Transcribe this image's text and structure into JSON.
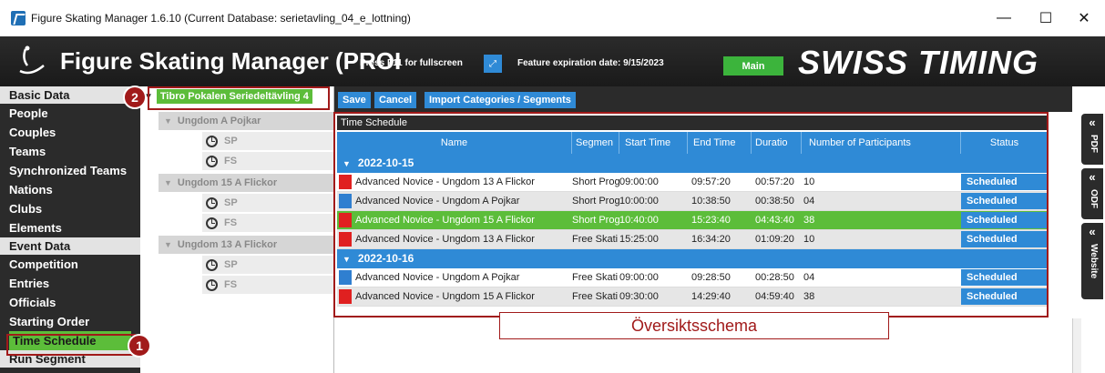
{
  "window": {
    "title": "Figure Skating Manager 1.6.10 (Current Database: serietavling_04_e_lottning)",
    "controls": {
      "minimize": "—",
      "maximize": "☐",
      "close": "✕"
    }
  },
  "banner": {
    "app_title": "Figure Skating Manager (PROI",
    "fullscreen_hint": "Press F11 for fullscreen",
    "fullscreen_icon": "⤢",
    "expiry": "Feature expiration date: 9/15/2023",
    "main_button": "Main",
    "brand": "SWISS TIMING"
  },
  "sidebar": {
    "sections": [
      {
        "header": "Basic Data",
        "items": [
          "People",
          "Couples",
          "Teams",
          "Synchronized Teams",
          "Nations",
          "Clubs",
          "Elements"
        ]
      },
      {
        "header": "Event Data",
        "items": [
          "Competition",
          "Entries",
          "Officials",
          "Starting Order",
          "Time Schedule"
        ]
      },
      {
        "header": "Run Segment",
        "items": []
      }
    ],
    "active_item": "Time Schedule"
  },
  "tree": {
    "root": "Tibro Pokalen Seriedeltävling 4",
    "categories": [
      {
        "name": "Ungdom A Pojkar",
        "segments": [
          "SP",
          "FS"
        ]
      },
      {
        "name": "Ungdom 15 A Flickor",
        "segments": [
          "SP",
          "FS"
        ]
      },
      {
        "name": "Ungdom 13 A Flickor",
        "segments": [
          "SP",
          "FS"
        ]
      }
    ]
  },
  "toolbar": {
    "save": "Save",
    "cancel": "Cancel",
    "import": "Import Categories / Segments"
  },
  "schedule": {
    "panel_title": "Time Schedule",
    "columns": [
      "Name",
      "Segmen",
      "Start Time",
      "End Time",
      "Duratio",
      "Number of Participants",
      "Status"
    ],
    "groups": [
      {
        "date": "2022-10-15",
        "rows": [
          {
            "color": "#e02020",
            "name": "Advanced Novice - Ungdom 13 A Flickor",
            "segment": "Short Prog",
            "start": "09:00:00",
            "end": "09:57:20",
            "duration": "00:57:20",
            "participants": "10",
            "status": "Scheduled"
          },
          {
            "color": "#2f7fd0",
            "name": "Advanced Novice - Ungdom A Pojkar",
            "segment": "Short Prog",
            "start": "10:00:00",
            "end": "10:38:50",
            "duration": "00:38:50",
            "participants": "04",
            "status": "Scheduled"
          },
          {
            "color": "#e02020",
            "name": "Advanced Novice - Ungdom 15 A Flickor",
            "segment": "Short Prog",
            "start": "10:40:00",
            "end": "15:23:40",
            "duration": "04:43:40",
            "participants": "38",
            "status": "Scheduled"
          },
          {
            "color": "#e02020",
            "name": "Advanced Novice - Ungdom 13 A Flickor",
            "segment": "Free Skati",
            "start": "15:25:00",
            "end": "16:34:20",
            "duration": "01:09:20",
            "participants": "10",
            "status": "Scheduled"
          }
        ]
      },
      {
        "date": "2022-10-16",
        "rows": [
          {
            "color": "#2f7fd0",
            "name": "Advanced Novice - Ungdom A Pojkar",
            "segment": "Free Skati",
            "start": "09:00:00",
            "end": "09:28:50",
            "duration": "00:28:50",
            "participants": "04",
            "status": "Scheduled"
          },
          {
            "color": "#e02020",
            "name": "Advanced Novice - Ungdom 15 A Flickor",
            "segment": "Free Skati",
            "start": "09:30:00",
            "end": "14:29:40",
            "duration": "04:59:40",
            "participants": "38",
            "status": "Scheduled"
          }
        ]
      }
    ],
    "selected_row": "0.2"
  },
  "side_tabs": [
    {
      "chevron": "«",
      "label": "PDF"
    },
    {
      "chevron": "«",
      "label": "ODF"
    },
    {
      "chevron": "«",
      "label": "Website"
    }
  ],
  "annotations": {
    "badge_1": "1",
    "badge_2": "2",
    "overview_label": "Översiktsschema"
  }
}
